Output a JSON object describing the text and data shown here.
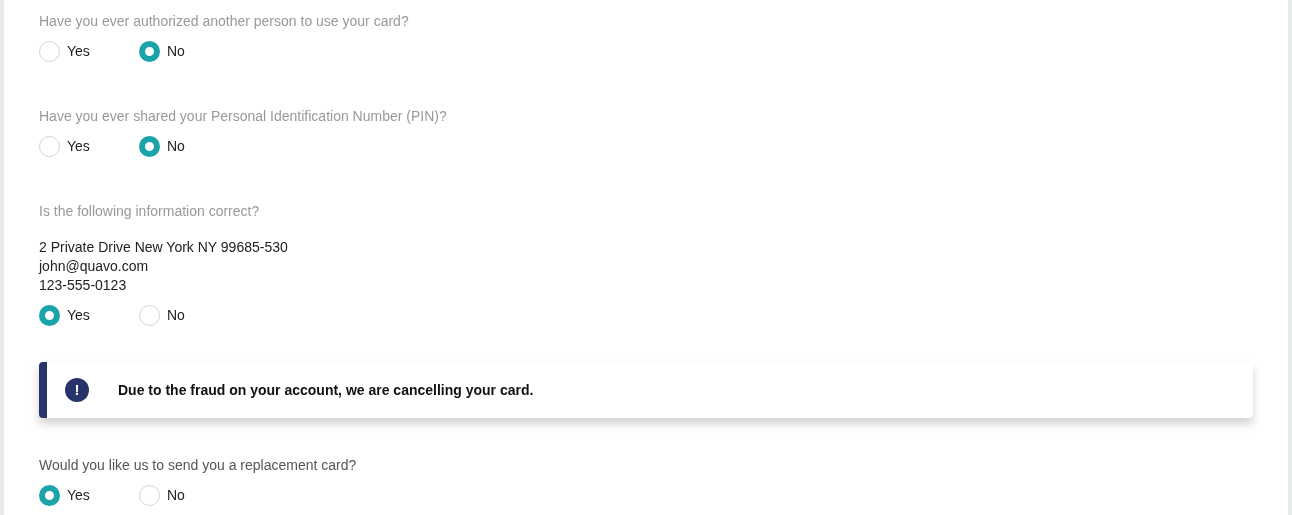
{
  "form": [
    {
      "kind": "question",
      "question": "Have you ever authorized another person to use your card?",
      "disabled": true,
      "options": [
        {
          "label": "Yes",
          "selected": false
        },
        {
          "label": "No",
          "selected": true
        }
      ]
    },
    {
      "kind": "question",
      "question": "Have you ever shared your Personal Identification Number (PIN)?",
      "disabled": true,
      "options": [
        {
          "label": "Yes",
          "selected": false
        },
        {
          "label": "No",
          "selected": true
        }
      ]
    },
    {
      "kind": "question",
      "question": "Is the following information correct?",
      "disabled": true,
      "info": [
        "2 Private Drive New York NY 99685-530",
        "john@quavo.com",
        "123-555-0123"
      ],
      "options": [
        {
          "label": "Yes",
          "selected": true
        },
        {
          "label": "No",
          "selected": false
        }
      ]
    },
    {
      "kind": "alert",
      "icon": "!",
      "message": "Due to the fraud on your account, we are cancelling your card."
    },
    {
      "kind": "question",
      "question": "Would you like us to send you a replacement card?",
      "disabled": false,
      "options": [
        {
          "label": "Yes",
          "selected": true
        },
        {
          "label": "No",
          "selected": false
        }
      ]
    }
  ]
}
